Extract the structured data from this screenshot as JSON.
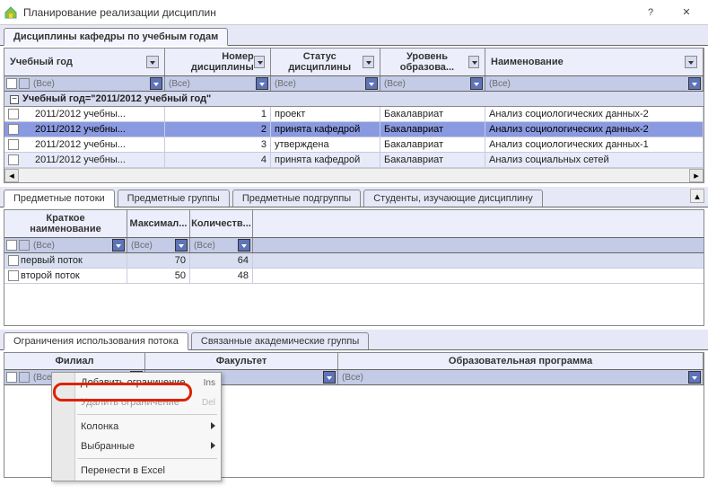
{
  "window": {
    "title": "Планирование реализации дисциплин",
    "help_label": "?",
    "close_label": "✕"
  },
  "main_tab": {
    "label": "Дисциплины кафедры по учебным годам"
  },
  "grid1": {
    "headers": [
      "Учебный год",
      "Номер дисциплины",
      "Статус дисциплины",
      "Уровень образова...",
      "Наименование"
    ],
    "filter_label": "(Все)",
    "group_row": "Учебный год=\"2011/2012 учебный год\"",
    "rows": [
      {
        "year": "2011/2012 учебны...",
        "num": "1",
        "status": "проект",
        "level": "Бакалавриат",
        "name": "Анализ социологических данных-2",
        "selected": false,
        "striped": false
      },
      {
        "year": "2011/2012 учебны...",
        "num": "2",
        "status": "принята кафедрой",
        "level": "Бакалавриат",
        "name": "Анализ социологических данных-2",
        "selected": true,
        "striped": false
      },
      {
        "year": "2011/2012 учебны...",
        "num": "3",
        "status": "утверждена",
        "level": "Бакалавриат",
        "name": "Анализ социологических данных-1",
        "selected": false,
        "striped": false
      },
      {
        "year": "2011/2012 учебны...",
        "num": "4",
        "status": "принята кафедрой",
        "level": "Бакалавриат",
        "name": "Анализ социальных сетей",
        "selected": false,
        "striped": true
      }
    ]
  },
  "tabs2": {
    "items": [
      "Предметные потоки",
      "Предметные группы",
      "Предметные подгруппы",
      "Студенты, изучающие дисциплину"
    ],
    "active": 0
  },
  "grid2": {
    "headers": [
      "Краткое наименование",
      "Максимал...",
      "Количеств..."
    ],
    "filter_label": "(Все)",
    "rows": [
      {
        "name": "первый поток",
        "max": "70",
        "count": "64",
        "selected": true
      },
      {
        "name": "второй поток",
        "max": "50",
        "count": "48",
        "selected": false
      }
    ]
  },
  "tabs3": {
    "items": [
      "Ограничения использования потока",
      "Связанные академические группы"
    ],
    "active": 0
  },
  "grid3": {
    "headers": [
      "Филиал",
      "Факультет",
      "Образовательная программа"
    ],
    "filter_label": "(Все)"
  },
  "context_menu": {
    "items": [
      {
        "label": "Добавить ограничение",
        "shortcut": "Ins",
        "disabled": false
      },
      {
        "label": "Удалить ограничение",
        "shortcut": "Del",
        "disabled": true
      },
      {
        "sep": true
      },
      {
        "label": "Колонка",
        "submenu": true,
        "disabled": false
      },
      {
        "label": "Выбранные",
        "submenu": true,
        "disabled": false
      },
      {
        "sep": true
      },
      {
        "label": "Перенести в Excel",
        "disabled": false
      }
    ]
  }
}
